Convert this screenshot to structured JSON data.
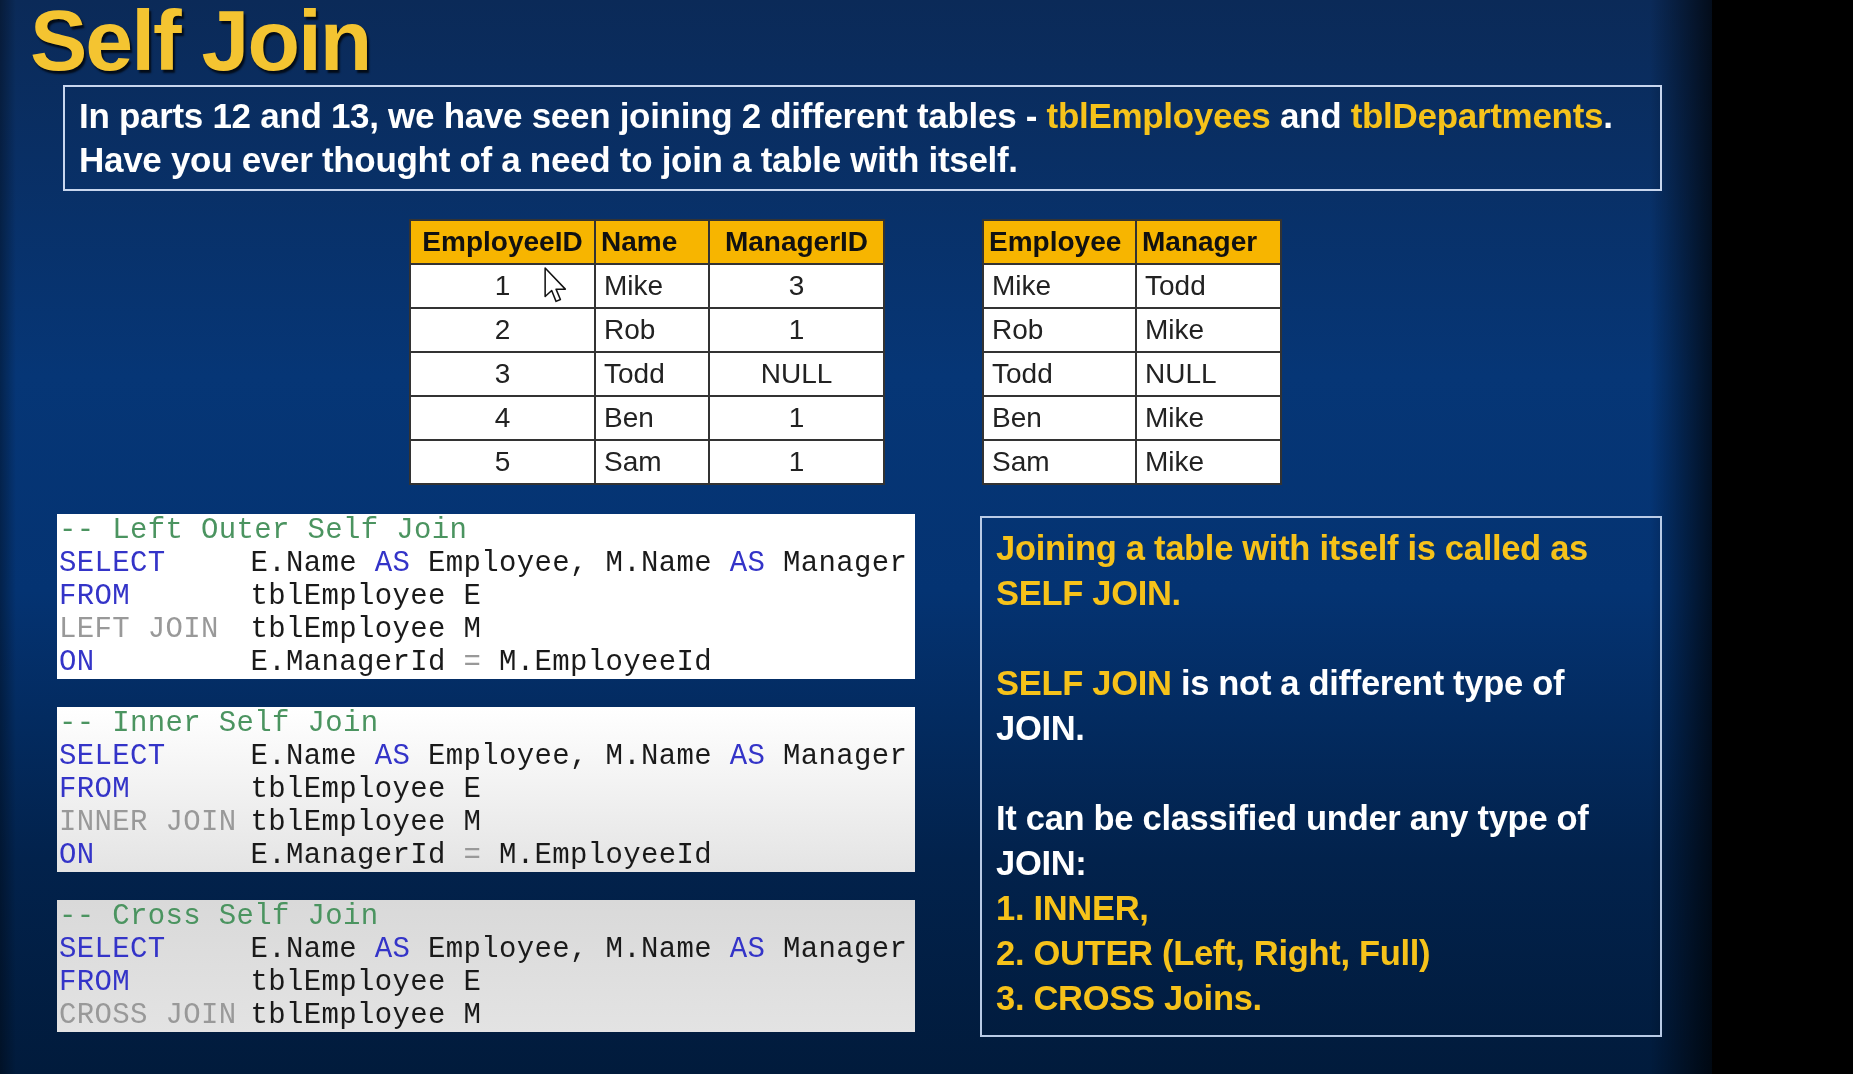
{
  "title": "Self Join",
  "intro": {
    "lines": [
      [
        {
          "text": "In parts 12 and 13, we have seen joining 2 different tables - ",
          "highlight": false
        },
        {
          "text": "tblEmployees",
          "highlight": true
        },
        {
          "text": " and ",
          "highlight": false
        },
        {
          "text": "tblDepartments",
          "highlight": true
        },
        {
          "text": ".",
          "highlight": false
        }
      ],
      [
        {
          "text": "Have you ever thought of a need to join a table with itself.",
          "highlight": false
        }
      ]
    ]
  },
  "tables": [
    {
      "columns": [
        {
          "label": "EmployeeID",
          "kind": "number"
        },
        {
          "label": "Name",
          "kind": "text"
        },
        {
          "label": "ManagerID",
          "kind": "number"
        }
      ],
      "rows": [
        [
          "1",
          "Mike",
          "3"
        ],
        [
          "2",
          "Rob",
          "1"
        ],
        [
          "3",
          "Todd",
          "NULL"
        ],
        [
          "4",
          "Ben",
          "1"
        ],
        [
          "5",
          "Sam",
          "1"
        ]
      ]
    },
    {
      "columns": [
        {
          "label": "Employee",
          "kind": "text"
        },
        {
          "label": "Manager",
          "kind": "text"
        }
      ],
      "rows": [
        [
          "Mike",
          "Todd"
        ],
        [
          "Rob",
          "Mike"
        ],
        [
          "Todd",
          "NULL"
        ],
        [
          "Ben",
          "Mike"
        ],
        [
          "Sam",
          "Mike"
        ]
      ]
    }
  ],
  "code_blocks": [
    {
      "lines": [
        {
          "kind": "comment",
          "text": "-- Left Outer Self Join"
        },
        {
          "kind": "statement",
          "tokens": [
            {
              "text": "SELECT",
              "kind": "clause"
            },
            {
              "text": "E.Name",
              "kind": "plain"
            },
            {
              "text": "AS",
              "kind": "keyword"
            },
            {
              "text": "Employee,",
              "kind": "plain"
            },
            {
              "text": "M.Name",
              "kind": "plain"
            },
            {
              "text": "AS",
              "kind": "keyword"
            },
            {
              "text": "Manager",
              "kind": "plain"
            }
          ]
        },
        {
          "kind": "statement",
          "tokens": [
            {
              "text": "FROM",
              "kind": "clause"
            },
            {
              "text": "tblEmployee E",
              "kind": "plain"
            }
          ]
        },
        {
          "kind": "statement",
          "tokens": [
            {
              "text": "LEFT JOIN",
              "kind": "join"
            },
            {
              "text": "tblEmployee M",
              "kind": "plain"
            }
          ]
        },
        {
          "kind": "statement",
          "tokens": [
            {
              "text": "ON",
              "kind": "clause"
            },
            {
              "text": "E.ManagerId",
              "kind": "plain"
            },
            {
              "text": "=",
              "kind": "operator"
            },
            {
              "text": "M.EmployeeId",
              "kind": "plain"
            }
          ]
        }
      ]
    },
    {
      "lines": [
        {
          "kind": "comment",
          "text": "-- Inner Self Join"
        },
        {
          "kind": "statement",
          "tokens": [
            {
              "text": "SELECT",
              "kind": "clause"
            },
            {
              "text": "E.Name",
              "kind": "plain"
            },
            {
              "text": "AS",
              "kind": "keyword"
            },
            {
              "text": "Employee,",
              "kind": "plain"
            },
            {
              "text": "M.Name",
              "kind": "plain"
            },
            {
              "text": "AS",
              "kind": "keyword"
            },
            {
              "text": "Manager",
              "kind": "plain"
            }
          ]
        },
        {
          "kind": "statement",
          "tokens": [
            {
              "text": "FROM",
              "kind": "clause"
            },
            {
              "text": "tblEmployee E",
              "kind": "plain"
            }
          ]
        },
        {
          "kind": "statement",
          "tokens": [
            {
              "text": "INNER JOIN",
              "kind": "join"
            },
            {
              "text": "tblEmployee M",
              "kind": "plain"
            }
          ]
        },
        {
          "kind": "statement",
          "tokens": [
            {
              "text": "ON",
              "kind": "clause"
            },
            {
              "text": "E.ManagerId",
              "kind": "plain"
            },
            {
              "text": "=",
              "kind": "operator"
            },
            {
              "text": "M.EmployeeId",
              "kind": "plain"
            }
          ]
        }
      ]
    },
    {
      "lines": [
        {
          "kind": "comment",
          "text": "-- Cross Self Join"
        },
        {
          "kind": "statement",
          "tokens": [
            {
              "text": "SELECT",
              "kind": "clause"
            },
            {
              "text": "E.Name",
              "kind": "plain"
            },
            {
              "text": "AS",
              "kind": "keyword"
            },
            {
              "text": "Employee,",
              "kind": "plain"
            },
            {
              "text": "M.Name",
              "kind": "plain"
            },
            {
              "text": "AS",
              "kind": "keyword"
            },
            {
              "text": "Manager",
              "kind": "plain"
            }
          ]
        },
        {
          "kind": "statement",
          "tokens": [
            {
              "text": "FROM",
              "kind": "clause"
            },
            {
              "text": "tblEmployee E",
              "kind": "plain"
            }
          ]
        },
        {
          "kind": "statement",
          "tokens": [
            {
              "text": "CROSS JOIN",
              "kind": "join"
            },
            {
              "text": "tblEmployee M",
              "kind": "plain"
            }
          ]
        }
      ]
    }
  ],
  "notes": {
    "paragraphs": [
      {
        "segments": [
          {
            "text": "Joining a table with itself is called as SELF JOIN.",
            "highlight": true
          }
        ]
      },
      {
        "segments": [
          {
            "text": "SELF JOIN",
            "highlight": true
          },
          {
            "text": " is not a different type of JOIN.",
            "highlight": false
          }
        ]
      },
      {
        "segments": [
          {
            "text": "It can be classified under any type of JOIN:",
            "highlight": false
          }
        ],
        "list_items": [
          "1. INNER,",
          "2. OUTER (Left, Right, Full)",
          "3. CROSS Joins."
        ]
      }
    ]
  }
}
